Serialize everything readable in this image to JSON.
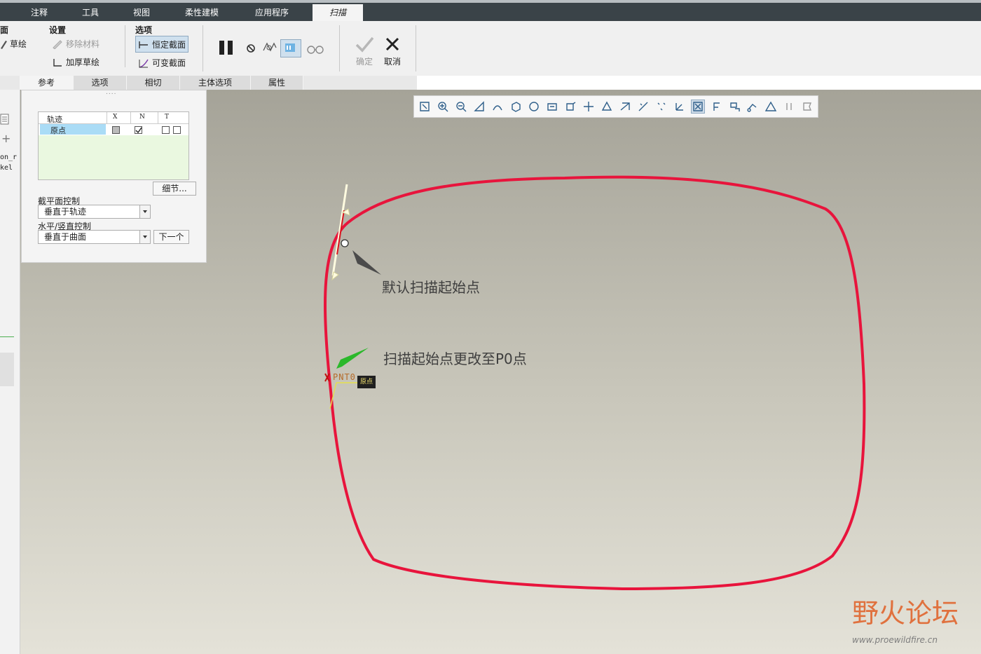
{
  "tabs": [
    "注释",
    "工具",
    "视图",
    "柔性建模",
    "应用程序",
    "扫描"
  ],
  "ribbon": {
    "group_partial_label": "面",
    "sketch_label": "草绘",
    "settings": {
      "title": "设置",
      "remove_material": "移除材料",
      "thicken_sketch": "加厚草绘"
    },
    "options": {
      "title": "选项",
      "constant_section": "恒定截面",
      "variable_section": "可变截面"
    },
    "ok_label": "确定",
    "cancel_label": "取消"
  },
  "subtabs": [
    "参考",
    "选项",
    "相切",
    "主体选项",
    "属性"
  ],
  "leftstrip": {
    "text1": "on_r",
    "text2": "kel"
  },
  "panel": {
    "grip": "....",
    "table": {
      "headers": [
        "轨迹",
        "X",
        "N",
        "T"
      ],
      "rows": [
        {
          "name": "原点",
          "x": false,
          "n": true,
          "t": [
            false,
            false
          ]
        }
      ]
    },
    "details_button": "细节...",
    "section_plane_label": "截平面控制",
    "section_plane_value": "垂直于轨迹",
    "hv_label": "水平/竖直控制",
    "hv_value": "垂直于曲面",
    "next_button": "下一个"
  },
  "viewport": {
    "annotation_default": "默认扫描起始点",
    "annotation_changed": "扫描起始点更改至P0点",
    "point_label": "PNT0",
    "origin_tag": "原点",
    "curve_color": "#e8143c",
    "watermark_title": "野火论坛",
    "watermark_url": "www.proewildfire.cn"
  },
  "view_toolbar_icons": [
    "refit-icon",
    "zoom-in-icon",
    "zoom-out-icon",
    "repaint-icon",
    "shading-icon",
    "standard-orientation-icon",
    "saved-views-icon",
    "view-manager-icon",
    "perspective-icon",
    "spin-center-icon",
    "display-style-icon",
    "datum-planes-icon",
    "datum-axes-icon",
    "datum-points-icon",
    "csys-icon",
    "point-tags-icon",
    "annotation-display-icon",
    "spin-icon",
    "network-icon",
    "warning-icon",
    "pause-icon",
    "flag-icon"
  ]
}
